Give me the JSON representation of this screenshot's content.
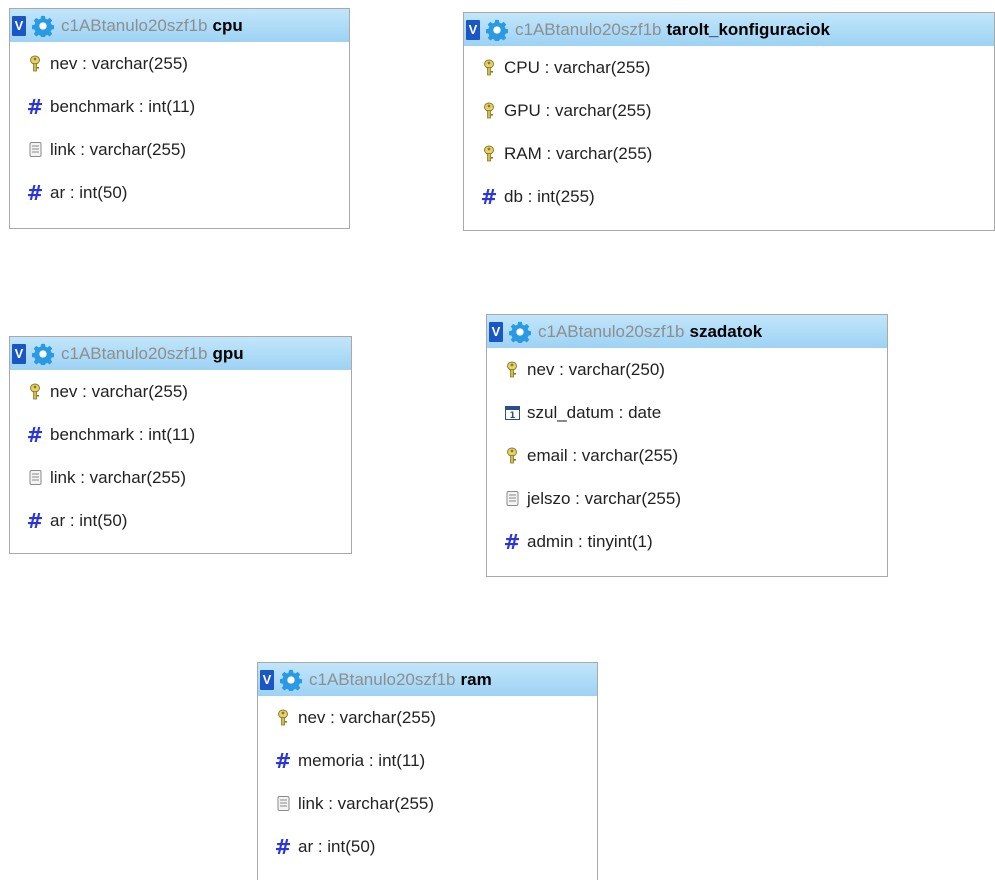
{
  "db_name": "c1ABtanulo20szf1b",
  "toggle_label": "V",
  "tables": [
    {
      "name": "cpu",
      "columns": [
        {
          "icon": "key-icon",
          "text": "nev : varchar(255)"
        },
        {
          "icon": "hash-icon",
          "text": "benchmark : int(11)"
        },
        {
          "icon": "text-field-icon",
          "text": "link : varchar(255)"
        },
        {
          "icon": "hash-icon",
          "text": "ar : int(50)"
        }
      ]
    },
    {
      "name": "tarolt_konfiguraciok",
      "columns": [
        {
          "icon": "key-icon",
          "text": "CPU : varchar(255)"
        },
        {
          "icon": "key-icon",
          "text": "GPU : varchar(255)"
        },
        {
          "icon": "key-icon",
          "text": "RAM : varchar(255)"
        },
        {
          "icon": "hash-icon",
          "text": "db : int(255)"
        }
      ]
    },
    {
      "name": "gpu",
      "columns": [
        {
          "icon": "key-icon",
          "text": "nev : varchar(255)"
        },
        {
          "icon": "hash-icon",
          "text": "benchmark : int(11)"
        },
        {
          "icon": "text-field-icon",
          "text": "link : varchar(255)"
        },
        {
          "icon": "hash-icon",
          "text": "ar : int(50)"
        }
      ]
    },
    {
      "name": "szadatok",
      "columns": [
        {
          "icon": "key-icon",
          "text": "nev : varchar(250)"
        },
        {
          "icon": "calendar-icon",
          "text": "szul_datum : date"
        },
        {
          "icon": "key-icon",
          "text": "email : varchar(255)"
        },
        {
          "icon": "text-field-icon",
          "text": "jelszo : varchar(255)"
        },
        {
          "icon": "hash-icon",
          "text": "admin : tinyint(1)"
        }
      ]
    },
    {
      "name": "ram",
      "columns": [
        {
          "icon": "key-icon",
          "text": "nev : varchar(255)"
        },
        {
          "icon": "hash-icon",
          "text": "memoria : int(11)"
        },
        {
          "icon": "text-field-icon",
          "text": "link : varchar(255)"
        },
        {
          "icon": "hash-icon",
          "text": "ar : int(50)"
        }
      ]
    }
  ]
}
